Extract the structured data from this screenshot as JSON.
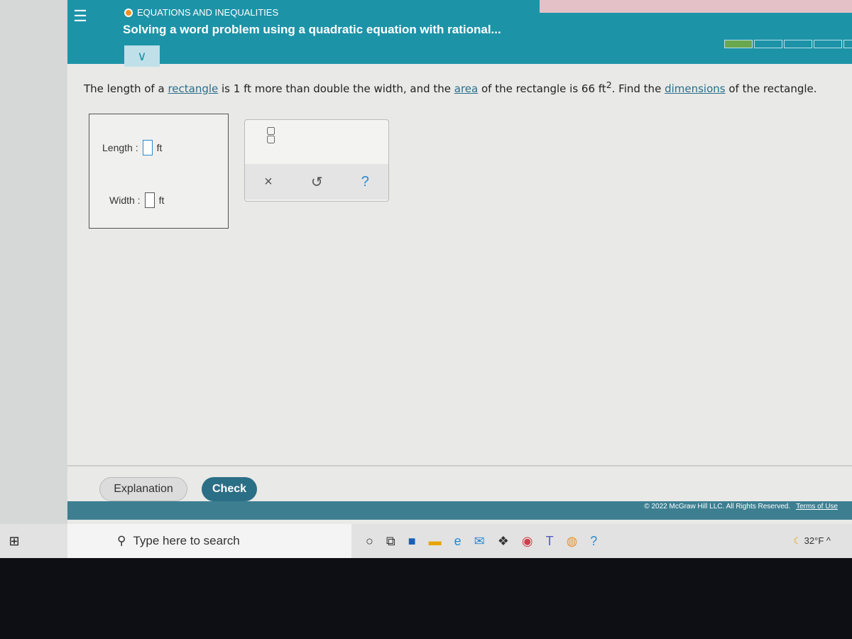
{
  "header": {
    "category": "EQUATIONS AND INEQUALITIES",
    "title": "Solving a word problem using a quadratic equation with rational...",
    "progress_filled": 1,
    "progress_total": 5
  },
  "question": {
    "p1": "The length of a ",
    "link1": "rectangle",
    "p2": " is 1 ft more than double the width, and the ",
    "link2": "area",
    "p3": " of the rectangle is 66 ft",
    "sup": "2",
    "p4": ". Find the ",
    "link3": "dimensions",
    "p5": " of the rectangle."
  },
  "answer": {
    "length_label": "Length :",
    "length_value": "",
    "width_label": "Width :",
    "width_value": "",
    "unit": "ft"
  },
  "tools": {
    "fraction": "□/□",
    "clear": "×",
    "undo": "↺",
    "help": "?"
  },
  "buttons": {
    "explanation": "Explanation",
    "check": "Check"
  },
  "footer": {
    "copyright": "© 2022 McGraw Hill LLC. All Rights Reserved.",
    "terms": "Terms of Use"
  },
  "taskbar": {
    "search_placeholder": "Type here to search",
    "temperature": "32°F"
  }
}
